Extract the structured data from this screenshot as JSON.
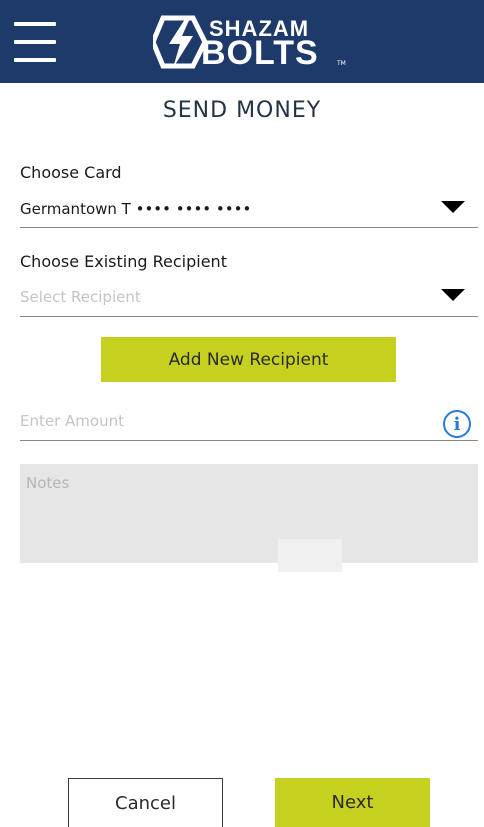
{
  "header": {
    "menu_icon": "hamburger-menu-icon",
    "logo_top": "SHAZAM",
    "logo_bottom": "BOLTS",
    "logo_tm": "TM",
    "brand_color": "#1d3a6a"
  },
  "page": {
    "title": "SEND MONEY"
  },
  "choose_card": {
    "label": "Choose Card",
    "value": "Germantown T •••• •••• ••••",
    "dropdown_icon": "dropdown-caret-icon"
  },
  "recipient": {
    "label": "Choose Existing Recipient",
    "placeholder": "Select Recipient",
    "dropdown_icon": "dropdown-caret-icon"
  },
  "add_recipient": {
    "label": "Add New Recipient",
    "color": "#c6d01f"
  },
  "amount": {
    "placeholder": "Enter Amount",
    "info_icon": "info-icon",
    "info_glyph": "i"
  },
  "notes": {
    "placeholder": "Notes"
  },
  "footer": {
    "cancel_label": "Cancel",
    "next_label": "Next"
  }
}
